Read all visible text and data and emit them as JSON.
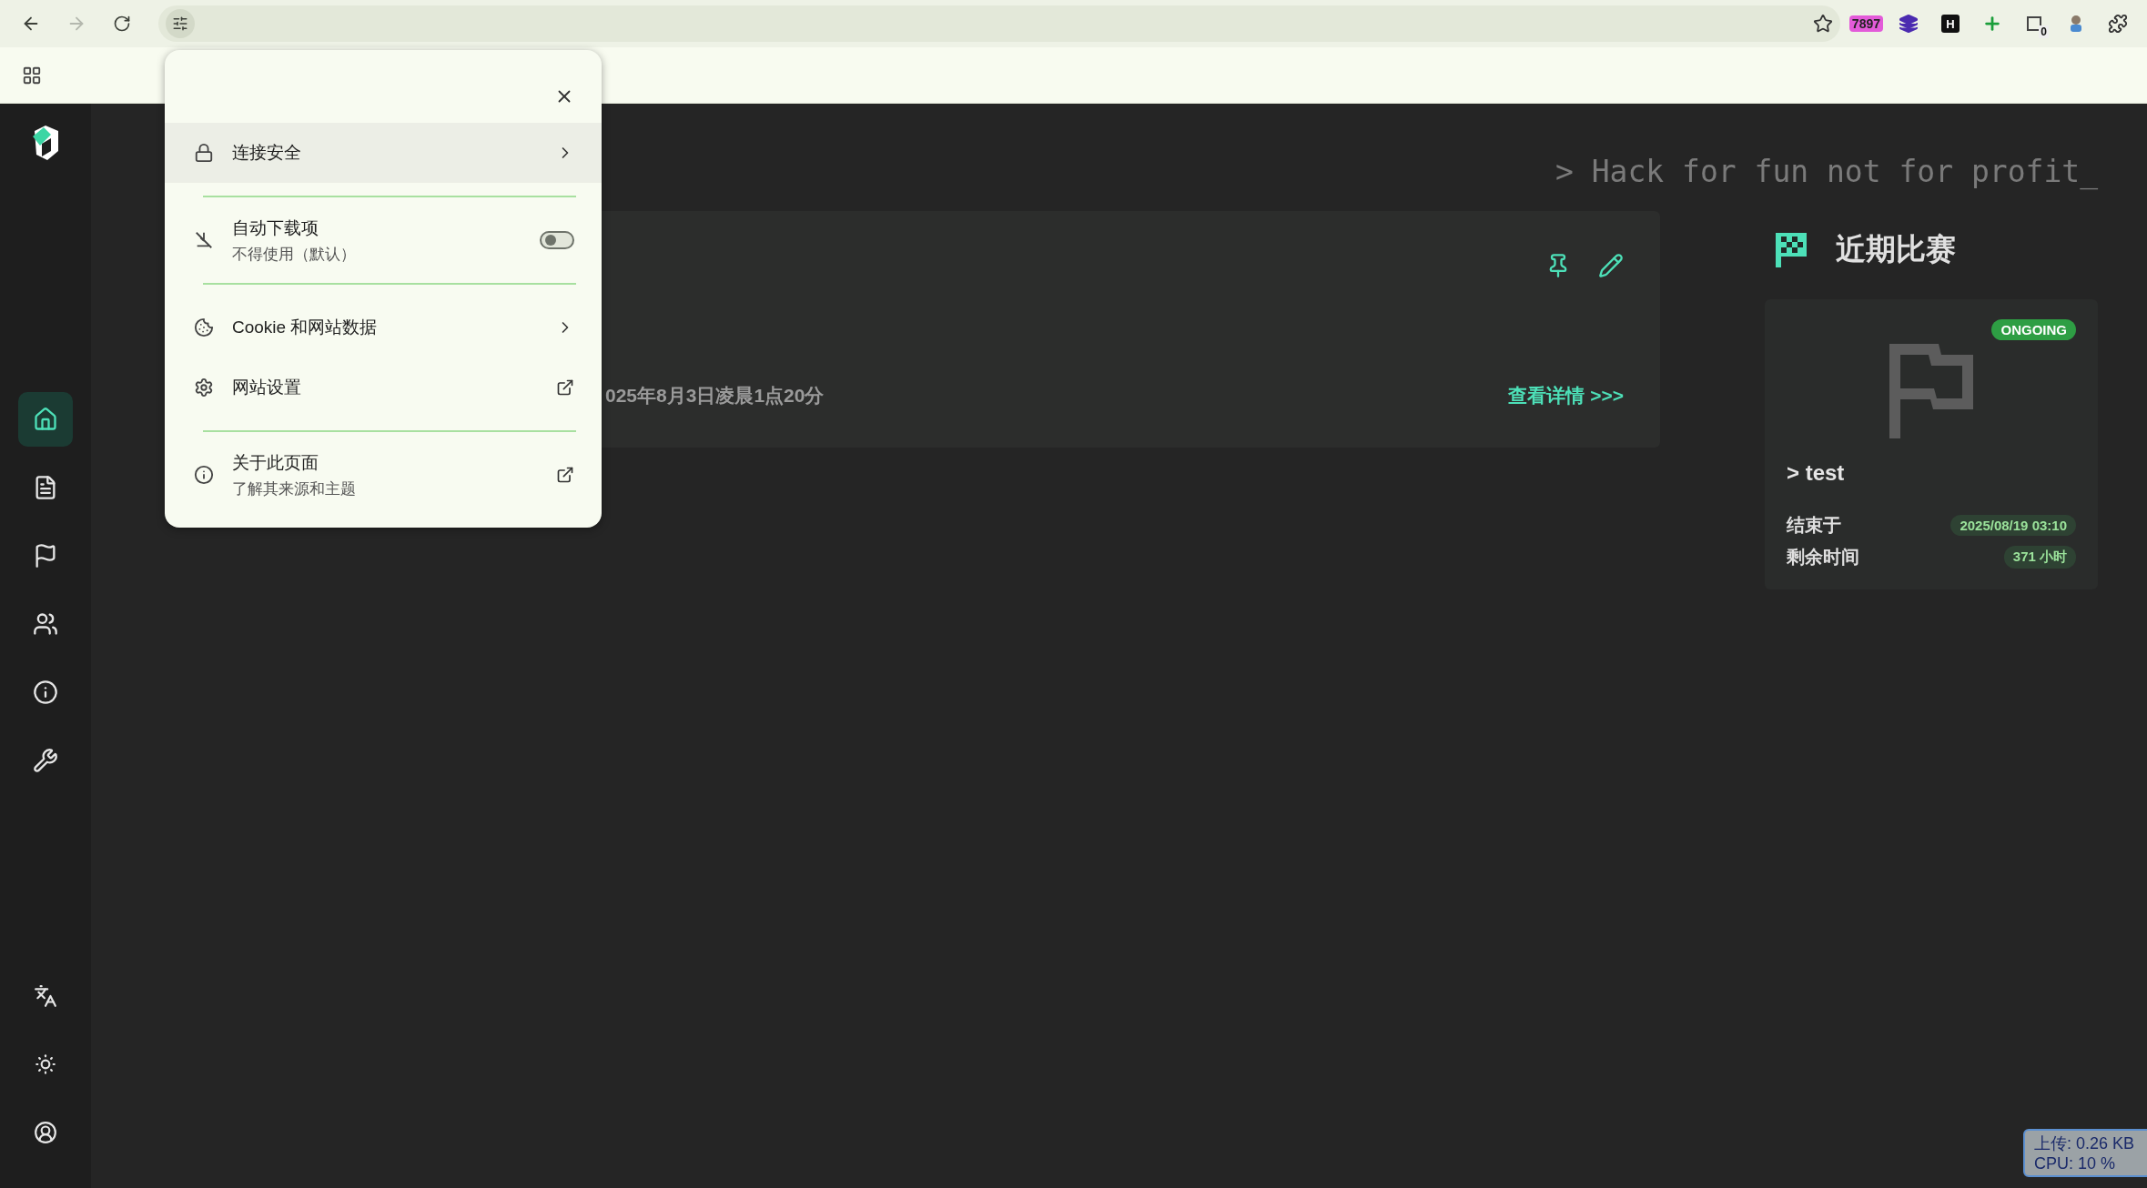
{
  "browser": {
    "back_enabled": true,
    "forward_enabled": false,
    "extensions": [
      {
        "kind": "counter",
        "text": "7897"
      },
      {
        "kind": "layers"
      },
      {
        "kind": "letter",
        "text": "H"
      },
      {
        "kind": "plus"
      },
      {
        "kind": "badge",
        "text": "0"
      },
      {
        "kind": "figure"
      },
      {
        "kind": "puzzle"
      }
    ]
  },
  "site_popup": {
    "items": [
      {
        "kind": "nav",
        "label": "连接安全",
        "selected": true
      },
      {
        "kind": "divider"
      },
      {
        "kind": "toggle",
        "label": "自动下载项",
        "sublabel": "不得使用（默认）",
        "on": false
      },
      {
        "kind": "divider"
      },
      {
        "kind": "nav",
        "label": "Cookie 和网站数据",
        "selected": false
      },
      {
        "kind": "external",
        "label": "网站设置"
      },
      {
        "kind": "divider"
      },
      {
        "kind": "external",
        "label": "关于此页面",
        "sublabel": "了解其来源和主题"
      }
    ]
  },
  "sidebar": {
    "items": [
      {
        "selected": true
      },
      {
        "selected": false
      },
      {
        "selected": false
      },
      {
        "selected": false
      },
      {
        "selected": false
      },
      {
        "selected": false
      }
    ]
  },
  "slogan": "> Hack for fun not for profit_",
  "post": {
    "date": "025年8月3日凌晨1点20分",
    "link": "查看详情 >>>"
  },
  "recent": {
    "title": "近期比赛",
    "games": [
      {
        "status": "ONGOING",
        "name": "> test",
        "end_label": "结束于",
        "end_value": "2025/08/19 03:10",
        "left_label": "剩余时间",
        "left_value": "371 小时"
      }
    ]
  },
  "net_monitor": {
    "lines": [
      "上传: 0.26 KB",
      "CPU: 10 %"
    ]
  }
}
